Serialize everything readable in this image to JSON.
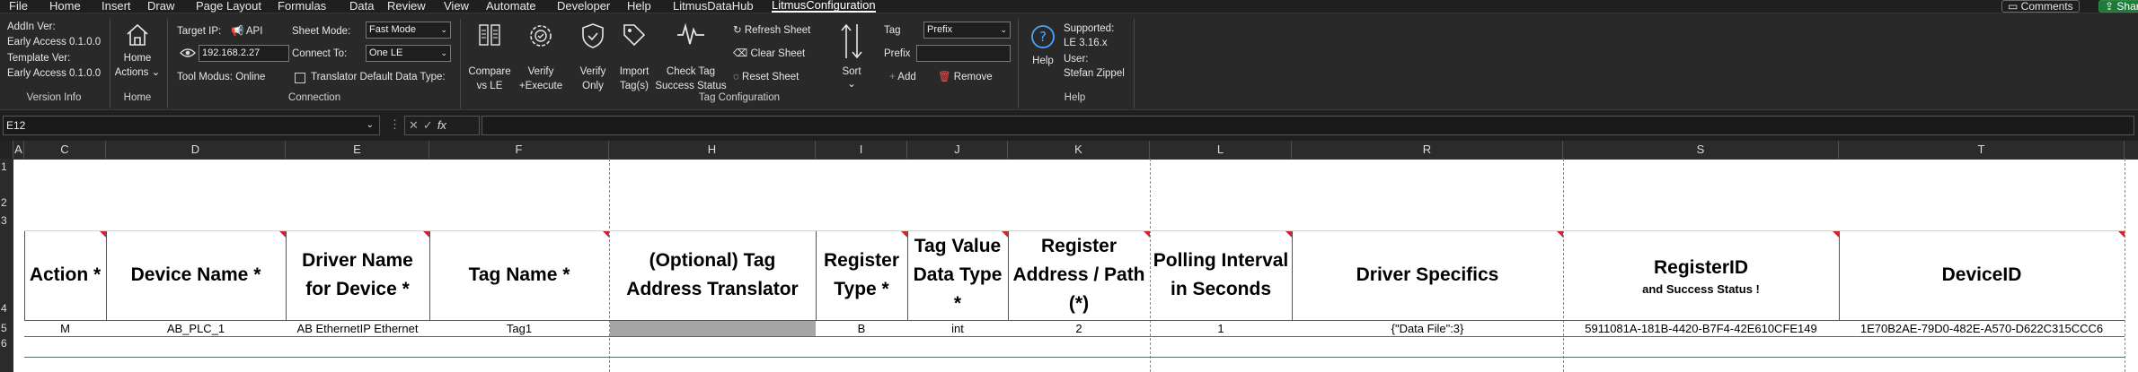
{
  "menu": {
    "items": [
      "File",
      "Home",
      "Insert",
      "Draw",
      "Page Layout",
      "Formulas",
      "Data",
      "Review",
      "View",
      "Automate",
      "Developer",
      "Help",
      "LitmusDataHub",
      "LitmusConfiguration"
    ],
    "comments_label": "Comments",
    "share_label": "Share"
  },
  "ribbon": {
    "version_info": {
      "addin_label": "AddIn Ver:",
      "addin_value": "Early Access 0.1.0.0",
      "template_label": "Template Ver:",
      "template_value": "Early Access 0.1.0.0",
      "group_label": "Version Info"
    },
    "home": {
      "button_line1": "Home",
      "button_line2": "Actions",
      "group_label": "Home"
    },
    "connection": {
      "target_ip_label": "Target IP:",
      "api_label": "API",
      "ip_value": "192.168.2.27",
      "sheet_mode_label": "Sheet Mode:",
      "sheet_mode_value": "Fast Mode",
      "connect_to_label": "Connect To:",
      "connect_to_value": "One LE",
      "tool_modus": "Tool Modus: Online",
      "translator_label": "Translator Default Data Type:",
      "group_label": "Connection"
    },
    "tag_config": {
      "compare_line1": "Compare",
      "compare_line2": "vs LE",
      "verify_exec_line1": "Verify",
      "verify_exec_line2": "+Execute",
      "verify_only_line1": "Verify",
      "verify_only_line2": "Only",
      "import_line1": "Import",
      "import_line2": "Tag(s)",
      "check_line1": "Check Tag",
      "check_line2": "Success Status",
      "refresh_label": "Refresh Sheet",
      "clear_label": "Clear Sheet",
      "reset_label": "Reset Sheet",
      "sort_label": "Sort",
      "tag_label": "Tag",
      "tag_dropdown_value": "Prefix",
      "prefix_label": "Prefix",
      "prefix_value": "",
      "add_label": "Add",
      "remove_label": "Remove",
      "group_label": "Tag Configuration"
    },
    "help": {
      "help_label": "Help",
      "supported_label": "Supported:",
      "supported_value": "LE 3.16.x",
      "user_label": "User:",
      "user_value": "Stefan Zippel",
      "group_label": "Help"
    }
  },
  "formula_bar": {
    "name_box": "E12",
    "fx": "fx",
    "formula": ""
  },
  "sheet": {
    "column_letters": [
      "A",
      "C",
      "D",
      "E",
      "F",
      "H",
      "I",
      "J",
      "K",
      "L",
      "R",
      "S",
      "T"
    ],
    "row_numbers": [
      "1",
      "2",
      "3",
      "4",
      "5",
      "6"
    ],
    "headers": {
      "action": "Action *",
      "device_name": "Device Name *",
      "driver_name": "Driver Name for Device *",
      "tag_name": "Tag Name *",
      "translator": "(Optional) Tag Address Translator",
      "register_type": "Register Type *",
      "tag_value_type": "Tag Value Data Type *",
      "register_address": "Register Address / Path (*)",
      "polling_interval": "Polling Interval in Seconds",
      "driver_specifics": "Driver Specifics",
      "register_id": "RegisterID",
      "register_id_sub": "and Success Status !",
      "device_id": "DeviceID"
    },
    "row5": {
      "action": "M",
      "device_name": "AB_PLC_1",
      "driver_name": "AB EthernetIP Ethernet",
      "tag_name": "Tag1",
      "translator": "",
      "register_type": "B",
      "tag_value_type": "int",
      "register_address": "2",
      "polling_interval": "1",
      "driver_specifics": "{\"Data File\":3}",
      "register_id": "5911081A-181B-4420-B7F4-42E610CFE149",
      "device_id": "1E70B2AE-79D0-482E-A570-D622C315CCC6"
    }
  },
  "colors": {
    "ribbon_bg": "#292929",
    "header_triangle": "#d0262a",
    "translator_fill": "#a6a6a6"
  }
}
